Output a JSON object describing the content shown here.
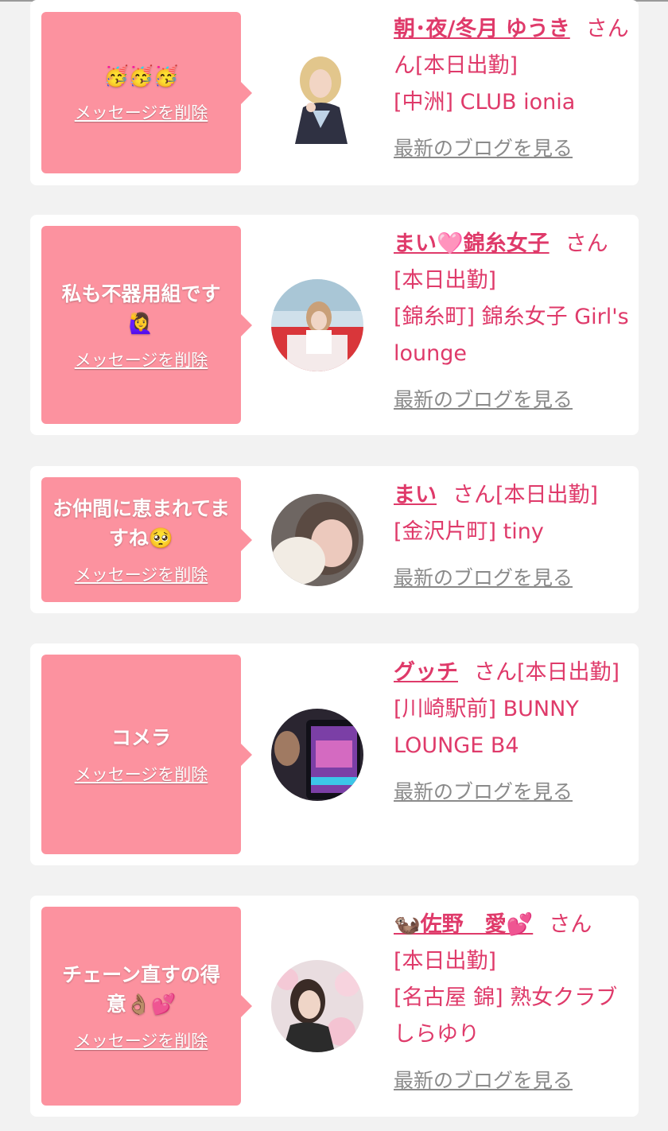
{
  "delete_label": "メッセージを削除",
  "blog_label": "最新のブログを見る",
  "san": "さん",
  "cards": [
    {
      "message": "🥳🥳🥳",
      "name": "朝･夜/冬月 ゆうき",
      "status": "ん[本日出勤]",
      "shop": "[中洲] CLUB ionia"
    },
    {
      "message": "私も不器用組です🙋‍♀️",
      "name": "まい🩷錦糸女子",
      "status": "[本日出勤]",
      "shop": "[錦糸町] 錦糸女子 Girl's lounge"
    },
    {
      "message": "お仲間に恵まれてますね🥺",
      "name": "まい",
      "status": "[本日出勤]",
      "shop": "[金沢片町] tiny"
    },
    {
      "message": "コメラ",
      "name": "グッチ",
      "status": "[本日出勤]",
      "shop": "[川崎駅前] BUNNY LOUNGE B4"
    },
    {
      "message": "チェーン直すの得意👌🏽💕",
      "name": "🦦佐野　愛💕",
      "status": "[本日出勤]",
      "shop": "[名古屋 錦] 熟女クラブ しらゆり"
    }
  ],
  "colors": {
    "background": "#f2f2f2",
    "card": "#ffffff",
    "bubble": "#fc929f",
    "accent_text": "#df3a6a",
    "link_grey": "#8a8a8a"
  },
  "icons": [
    "profile-photo",
    "profile-photo",
    "profile-photo",
    "profile-photo",
    "profile-photo"
  ]
}
